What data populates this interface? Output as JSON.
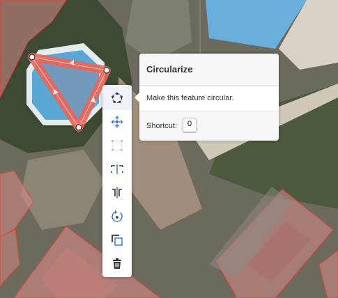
{
  "tooltip": {
    "title": "Circularize",
    "description": "Make this feature circular.",
    "shortcut_label": "Shortcut:",
    "shortcut_key": "O"
  },
  "edit_menu": {
    "items": [
      {
        "name": "circularize",
        "icon": "circularize-icon",
        "active": true
      },
      {
        "name": "move",
        "icon": "move-icon"
      },
      {
        "name": "square",
        "icon": "orthogonalize-icon",
        "disabled": true
      },
      {
        "name": "reflect-long",
        "icon": "reflect-long-icon"
      },
      {
        "name": "reflect-short",
        "icon": "reflect-short-icon"
      },
      {
        "name": "rotate",
        "icon": "rotate-icon"
      },
      {
        "name": "extract",
        "icon": "copy-icon"
      },
      {
        "name": "delete",
        "icon": "trash-icon"
      }
    ]
  },
  "colors": {
    "selection": "#e9665a",
    "building_fill": "#d98b86",
    "building_stroke": "#e3443a",
    "accent": "#4a84d8",
    "pool": "#5aa6d4"
  }
}
